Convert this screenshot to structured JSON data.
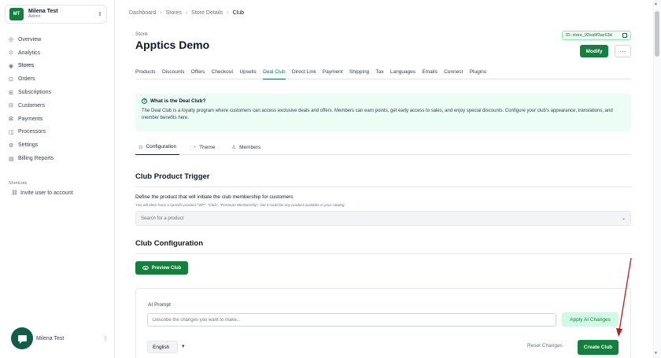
{
  "account": {
    "initials": "MT",
    "name": "Milena Test",
    "role": "Admin"
  },
  "nav": {
    "items": [
      {
        "label": "Overview",
        "icon": "◎"
      },
      {
        "label": "Analytics",
        "icon": "⊙"
      },
      {
        "label": "Stores",
        "icon": "◉"
      },
      {
        "label": "Orders",
        "icon": "⊡"
      },
      {
        "label": "Subscriptions",
        "icon": "⊞"
      },
      {
        "label": "Customers",
        "icon": "⊟"
      },
      {
        "label": "Payments",
        "icon": "⊠"
      },
      {
        "label": "Processors",
        "icon": "◫"
      },
      {
        "label": "Settings",
        "icon": "⚙"
      },
      {
        "label": "Billing Reports",
        "icon": "▤"
      }
    ],
    "shortcuts_title": "Shortcuts",
    "shortcut_item": "Invite user to account",
    "user_name": "Milena Test"
  },
  "breadcrumb": [
    "Dashboard",
    "Stores",
    "Store Details",
    "Club"
  ],
  "header": {
    "store_label": "Store",
    "title": "Apptics Demo",
    "store_id": "ID: store_02ea9f3ac63d",
    "modify_label": "Modify",
    "more_label": "···"
  },
  "tabs": [
    "Products",
    "Discounts",
    "Offers",
    "Checkout",
    "Upsells",
    "Deal Club",
    "Direct Link",
    "Payment",
    "Shipping",
    "Tax",
    "Languages",
    "Emails",
    "Connect",
    "Plugins"
  ],
  "info": {
    "title": "What is the Deal Club?",
    "body": "The Deal Club is a loyalty program where customers can access exclusive deals and offers. Members can earn points, get early access to sales, and enjoy special discounts. Configure your club's appearance, translations, and member benefits here."
  },
  "sub_tabs": [
    "Configuration",
    "Theme",
    "Members"
  ],
  "trigger": {
    "title": "Club Product Trigger",
    "description": "Define the product that will initiate the club membership for customers",
    "hint": "You will often have a specific product \"VIP\", \"Club\", \"Premium Membership\", but it could be any product available in your catalog",
    "search_placeholder": "Search for a product"
  },
  "config": {
    "title": "Club Configuration",
    "preview_label": "Preview Club",
    "ai_prompt_label": "AI Prompt",
    "ai_placeholder": "Describe the changes you want to make...",
    "apply_label": "Apply AI Changes",
    "language": "English",
    "reset_label": "Reset Changes",
    "create_label": "Create Club"
  },
  "colors": {
    "brand": "#15803d",
    "info_bg": "#ecfdf5",
    "annotation": "#b91c1c"
  }
}
